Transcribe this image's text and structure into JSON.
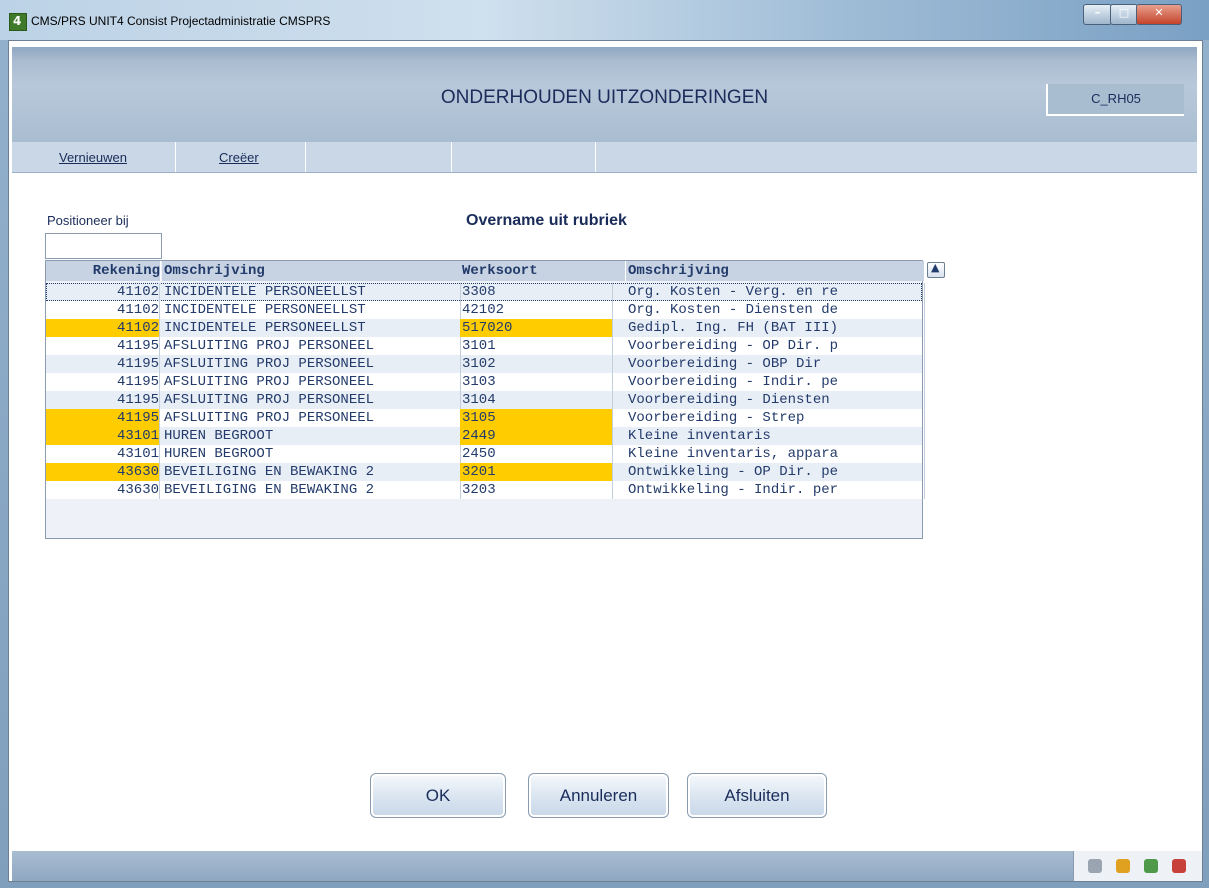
{
  "window": {
    "title": "CMS/PRS  UNIT4 Consist  Projectadministratie CMSPRS",
    "app_icon": "4",
    "controls": {
      "minimize": "–",
      "maximize": "□",
      "close": "✕"
    }
  },
  "header": {
    "title": "ONDERHOUDEN UITZONDERINGEN",
    "code": "C_RH05"
  },
  "menu": {
    "items": [
      {
        "label": "Vernieuwen"
      },
      {
        "label": "Creëer"
      }
    ]
  },
  "position": {
    "label": "Positioneer bij",
    "value": ""
  },
  "table": {
    "title": "Overname uit rubriek",
    "headers": [
      "Rekening",
      "Omschrijving",
      "Werksoort",
      "Omschrijving"
    ],
    "rows": [
      {
        "rekening": "41102",
        "omschrijving": "INCIDENTELE PERSONEELLST",
        "werksoort": "3308",
        "omschrijving2": "Org. Kosten - Verg. en re",
        "highlight": false
      },
      {
        "rekening": "41102",
        "omschrijving": "INCIDENTELE PERSONEELLST",
        "werksoort": "42102",
        "omschrijving2": "Org. Kosten - Diensten de",
        "highlight": false
      },
      {
        "rekening": "41102",
        "omschrijving": "INCIDENTELE PERSONEELLST",
        "werksoort": "517020",
        "omschrijving2": "Gedipl. Ing. FH (BAT III)",
        "highlight": true
      },
      {
        "rekening": "41195",
        "omschrijving": "AFSLUITING PROJ PERSONEEL",
        "werksoort": "3101",
        "omschrijving2": "Voorbereiding - OP Dir. p",
        "highlight": false
      },
      {
        "rekening": "41195",
        "omschrijving": "AFSLUITING PROJ PERSONEEL",
        "werksoort": "3102",
        "omschrijving2": "Voorbereiding - OBP Dir",
        "highlight": false
      },
      {
        "rekening": "41195",
        "omschrijving": "AFSLUITING PROJ PERSONEEL",
        "werksoort": "3103",
        "omschrijving2": "Voorbereiding - Indir. pe",
        "highlight": false
      },
      {
        "rekening": "41195",
        "omschrijving": "AFSLUITING PROJ PERSONEEL",
        "werksoort": "3104",
        "omschrijving2": "Voorbereiding - Diensten",
        "highlight": false
      },
      {
        "rekening": "41195",
        "omschrijving": "AFSLUITING PROJ PERSONEEL",
        "werksoort": "3105",
        "omschrijving2": "Voorbereiding - Strep",
        "highlight": true
      },
      {
        "rekening": "43101",
        "omschrijving": "HUREN BEGROOT",
        "werksoort": "2449",
        "omschrijving2": "Kleine inventaris",
        "highlight": true
      },
      {
        "rekening": "43101",
        "omschrijving": "HUREN BEGROOT",
        "werksoort": "2450",
        "omschrijving2": "Kleine inventaris, appara",
        "highlight": false
      },
      {
        "rekening": "43630",
        "omschrijving": "BEVEILIGING EN BEWAKING 2",
        "werksoort": "3201",
        "omschrijving2": "Ontwikkeling - OP Dir. pe",
        "highlight": true
      },
      {
        "rekening": "43630",
        "omschrijving": "BEVEILIGING EN BEWAKING 2",
        "werksoort": "3203",
        "omschrijving2": "Ontwikkeling - Indir. per",
        "highlight": false
      }
    ]
  },
  "buttons": {
    "ok": "OK",
    "cancel": "Annuleren",
    "exit": "Afsluiten"
  },
  "colors": {
    "highlight": "#ffcc00",
    "text": "#233b6b",
    "header_bg": "#b8c8da"
  },
  "tray_icons": [
    "tools-icon",
    "hammer-icon",
    "users-icon",
    "cube-icon"
  ]
}
